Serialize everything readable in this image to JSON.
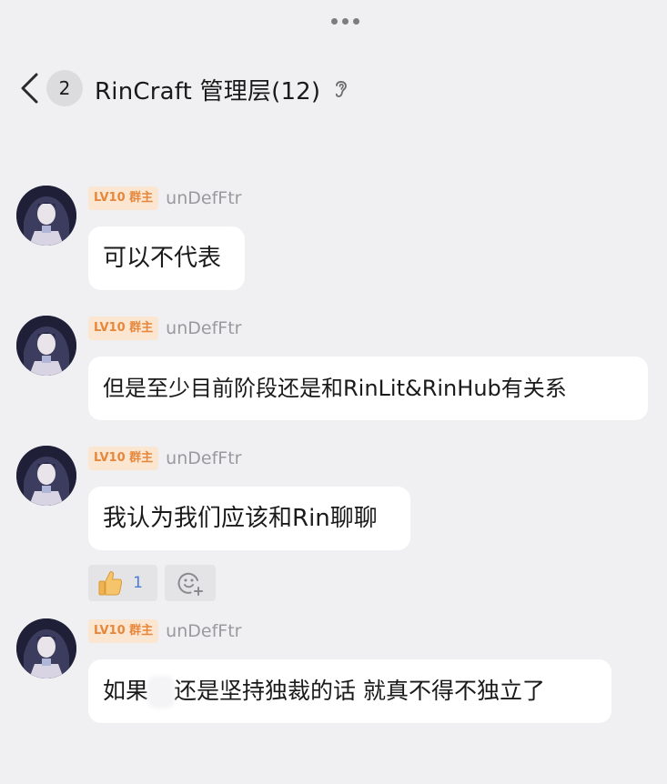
{
  "header": {
    "unread_count": "2",
    "title": "RinCraft 管理层(12)"
  },
  "messages": [
    {
      "level": "LV10 群主",
      "sender": "unDefFtr",
      "text": "可以不代表"
    },
    {
      "level": "LV10 群主",
      "sender": "unDefFtr",
      "text": "但是至少目前阶段还是和RinLit&RinHub有关系"
    },
    {
      "level": "LV10 群主",
      "sender": "unDefFtr",
      "text": "我认为我们应该和Rin聊聊"
    },
    {
      "level": "LV10 群主",
      "sender": "unDefFtr",
      "text_before": "如果",
      "text_after": "还是坚持独裁的话 就真不得不独立了"
    }
  ],
  "reactions": {
    "like_count": "1"
  },
  "colors": {
    "background": "#f0f0f2",
    "bubble": "#ffffff",
    "level_badge_bg": "#fbe6d2",
    "level_badge_text": "#e6873b",
    "count_blue": "#4b7bd6"
  },
  "icons": [
    "more-horizontal-icon",
    "back-arrow-icon",
    "ear-icon",
    "thumbs-up-icon",
    "add-emoji-icon"
  ]
}
